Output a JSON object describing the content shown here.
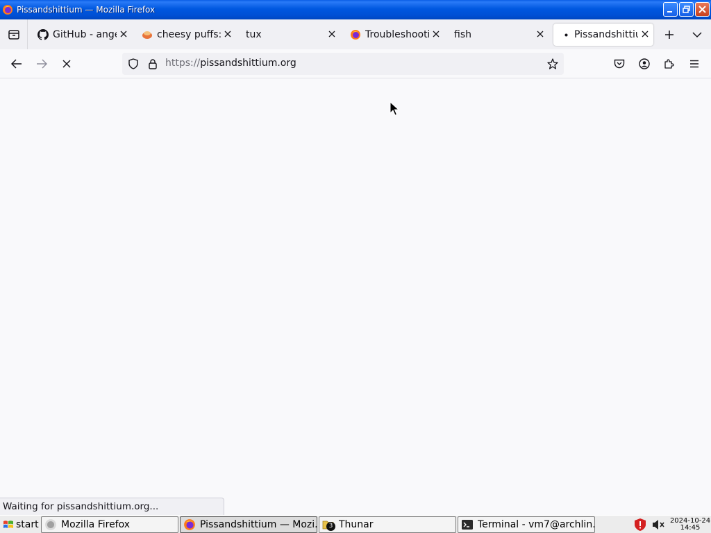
{
  "window": {
    "title": "Pissandshittium — Mozilla Firefox"
  },
  "tabs": [
    {
      "label": "GitHub - ange",
      "icon": "github-icon"
    },
    {
      "label": "cheesy puffs:",
      "icon": "cheesy-puffs-icon"
    },
    {
      "label": "tux",
      "icon": ""
    },
    {
      "label": "Troubleshootin",
      "icon": "firefox-icon"
    },
    {
      "label": "fish",
      "icon": ""
    },
    {
      "label": "Pissandshittiur",
      "icon": "loading-dot-icon",
      "active": true
    }
  ],
  "url": {
    "scheme": "https://",
    "host": "pissandshittium.org"
  },
  "status": {
    "text": "Waiting for pissandshittium.org..."
  },
  "taskbar": {
    "start_label": "start",
    "items": [
      {
        "label": "Mozilla Firefox",
        "icon": "firefox-icon"
      },
      {
        "label": "Pissandshittium — Mozi...",
        "icon": "firefox-icon"
      },
      {
        "label": "Thunar",
        "icon": "folder-icon",
        "badge": "3"
      },
      {
        "label": "Terminal - vm7@archlin...",
        "icon": "terminal-icon"
      }
    ],
    "clock_date": "2024-10-24",
    "clock_time": "14:45"
  }
}
